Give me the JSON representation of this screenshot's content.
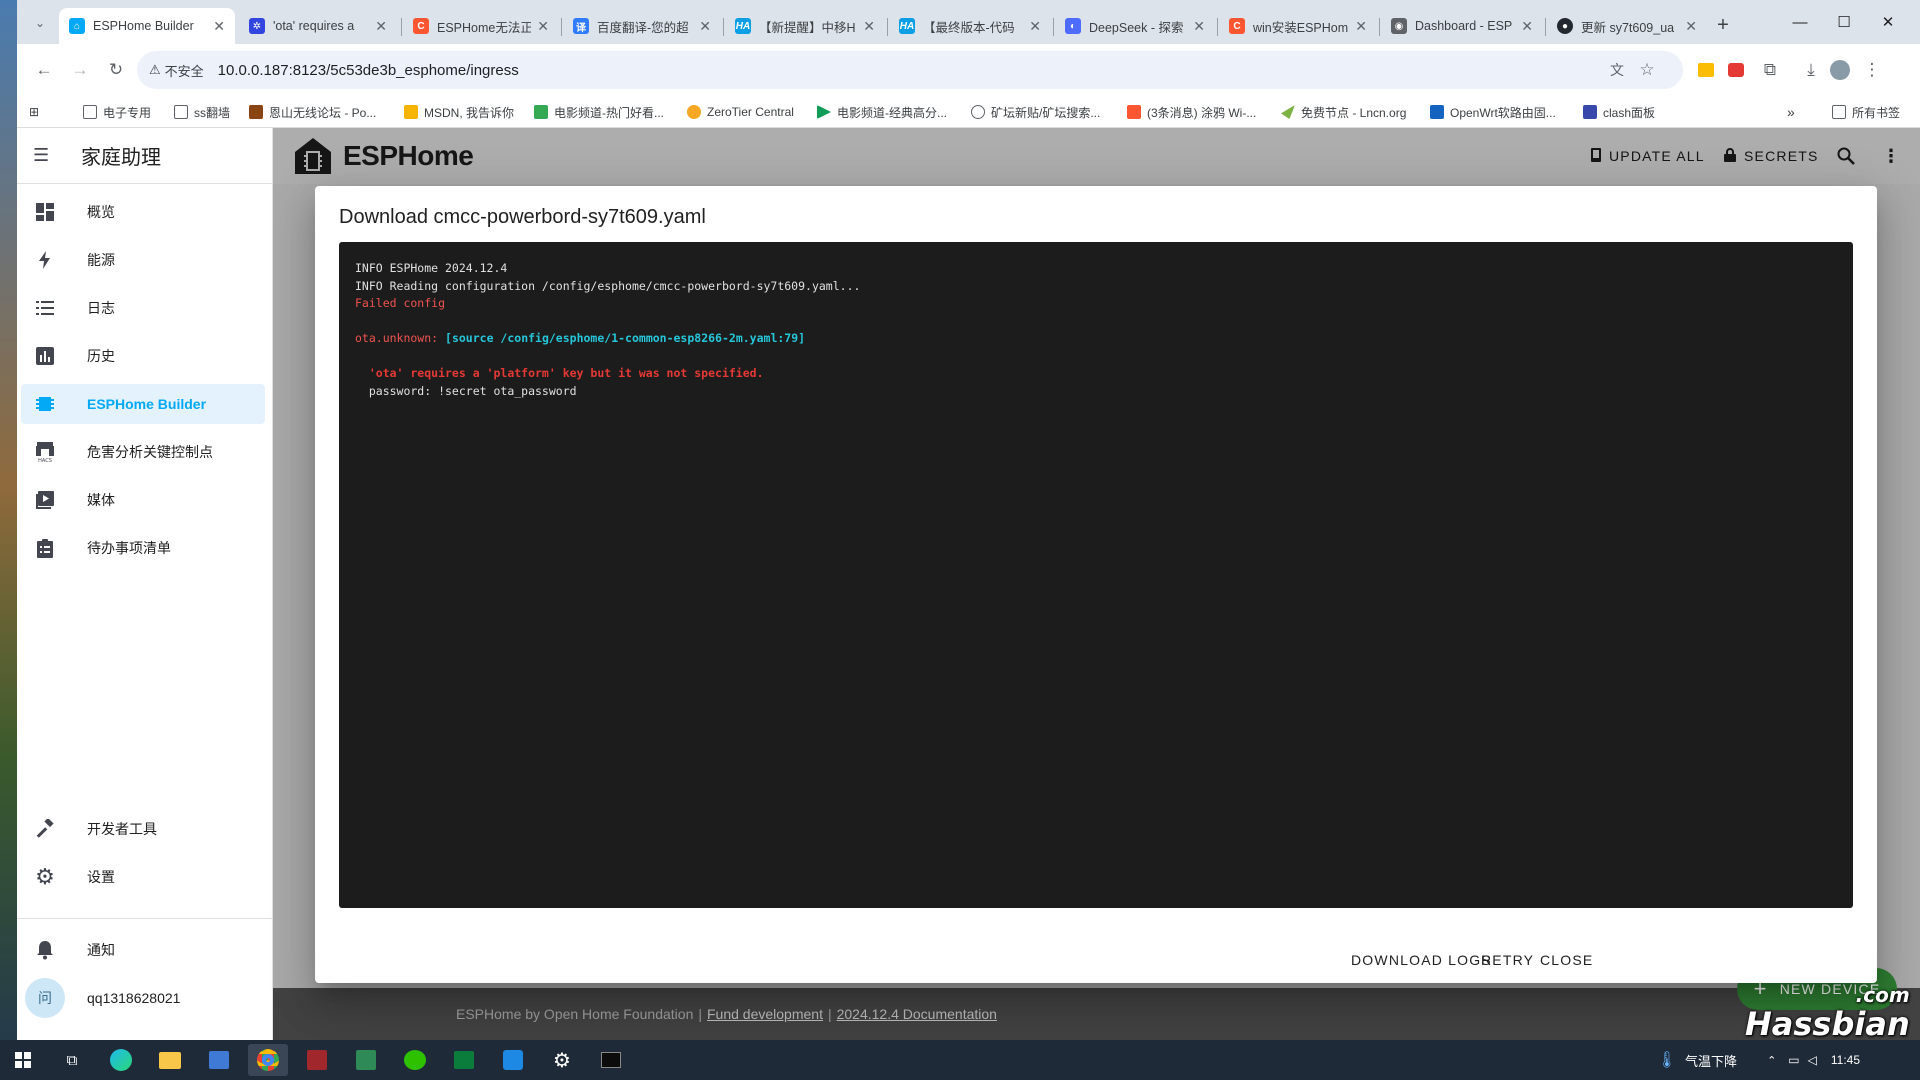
{
  "browser": {
    "tabs": [
      {
        "title": "ESPHome Builder",
        "active": true,
        "icon": "ha-icon",
        "color": "#03a9f4"
      },
      {
        "title": "'ota' requires a",
        "icon": "baidu-icon",
        "color": "#3245df"
      },
      {
        "title": "ESPHome无法正",
        "icon": "csdn-icon",
        "color": "#fc5531"
      },
      {
        "title": "百度翻译-您的超",
        "icon": "translate-icon",
        "color": "#2f7bfc"
      },
      {
        "title": "【新提醒】中移H",
        "icon": "ha-forum-icon",
        "color": "#0c9fe6"
      },
      {
        "title": "【最终版本-代码",
        "icon": "ha-forum-icon",
        "color": "#0c9fe6"
      },
      {
        "title": "DeepSeek - 探索",
        "icon": "deepseek-icon",
        "color": "#4d6bfe"
      },
      {
        "title": "win安装ESPHom",
        "icon": "csdn-icon",
        "color": "#fc5531"
      },
      {
        "title": "Dashboard - ESP",
        "icon": "dashboard-icon",
        "color": "#5f6368"
      },
      {
        "title": "更新 sy7t609_ua",
        "icon": "github-icon",
        "color": "#24292f"
      }
    ],
    "address": {
      "security_label": "不安全",
      "url": "10.0.0.187:8123/5c53de3b_esphome/ingress"
    },
    "bookmarks": [
      {
        "label": "电子专用",
        "icon": "folder-icon"
      },
      {
        "label": "ss翻墙",
        "icon": "folder-icon"
      },
      {
        "label": "恩山无线论坛 - Po...",
        "icon": "right-icon"
      },
      {
        "label": "MSDN, 我告诉你",
        "icon": "msdn-icon"
      },
      {
        "label": "电影频道-热门好看...",
        "icon": "movie-icon"
      },
      {
        "label": "ZeroTier Central",
        "icon": "zerotier-icon"
      },
      {
        "label": "电影频道-经典高分...",
        "icon": "play-icon"
      },
      {
        "label": "矿坛新贴/矿坛搜索...",
        "icon": "globe-icon"
      },
      {
        "label": "(3条消息) 涂鸦 Wi-...",
        "icon": "csdn-icon"
      },
      {
        "label": "免费节点 - Lncn.org",
        "icon": "plane-icon"
      },
      {
        "label": "OpenWrt软路由固...",
        "icon": "openwrt-icon"
      },
      {
        "label": "clash面板",
        "icon": "clash-icon"
      }
    ],
    "bookmarks_all": "所有书签"
  },
  "sidebar": {
    "title": "家庭助理",
    "items": [
      {
        "label": "概览",
        "icon": "dashboard-grid-icon"
      },
      {
        "label": "能源",
        "icon": "lightning-icon"
      },
      {
        "label": "日志",
        "icon": "list-icon"
      },
      {
        "label": "历史",
        "icon": "chart-bar-icon"
      },
      {
        "label": "ESPHome Builder",
        "icon": "chip-icon",
        "selected": true
      },
      {
        "label": "危害分析关键控制点",
        "icon": "hacs-icon"
      },
      {
        "label": "媒体",
        "icon": "media-play-icon"
      },
      {
        "label": "待办事项清单",
        "icon": "clipboard-list-icon"
      }
    ],
    "developer_tools": "开发者工具",
    "settings": "设置",
    "notifications": "通知",
    "user_initial": "问",
    "user_name": "qq1318628021"
  },
  "esphome": {
    "title": "ESPHome",
    "update_all": "UPDATE ALL",
    "secrets": "SECRETS",
    "footer": {
      "credit": "ESPHome by Open Home Foundation",
      "fund": "Fund development",
      "docs": "2024.12.4 Documentation"
    },
    "new_device": "NEW DEVICE"
  },
  "dialog": {
    "title": "Download cmcc-powerbord-sy7t609.yaml",
    "log": {
      "line1": "INFO ESPHome 2024.12.4",
      "line2": "INFO Reading configuration /config/esphome/cmcc-powerbord-sy7t609.yaml...",
      "line3": "Failed config",
      "line4_key": "ota.unknown:",
      "line4_src": "[source /config/esphome/1-common-esp8266-2m.yaml:79]",
      "line5": "  'ota' requires a 'platform' key but it was not specified.",
      "line6": "  password: !secret ota_password"
    },
    "actions": {
      "download_logs": "DOWNLOAD LOGS",
      "retry": "RETRY",
      "close": "CLOSE"
    }
  },
  "taskbar": {
    "weather": "气温下降",
    "time": "11:45"
  },
  "watermark": {
    "main": "Hassbian",
    "sub": ".com"
  },
  "colors": {
    "accent": "#03a9f4",
    "console_bg": "#1c1c1c",
    "error": "#ef5350",
    "source": "#26c6da",
    "fab": "#2e7d32"
  }
}
